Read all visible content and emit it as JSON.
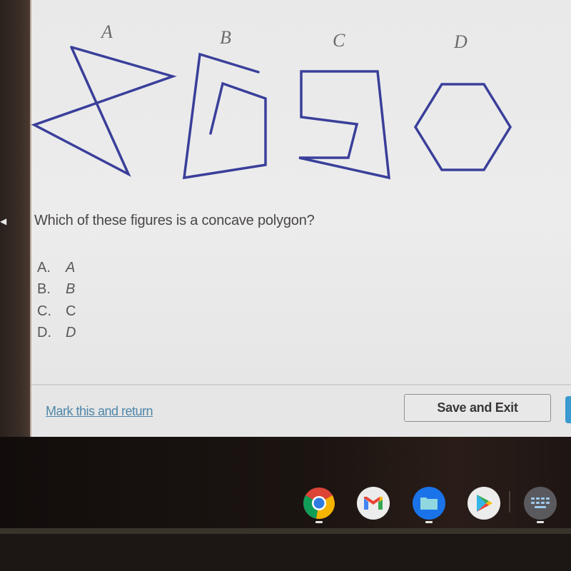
{
  "figures": {
    "labels": [
      "A",
      "B",
      "C",
      "D"
    ],
    "stroke_color": "#3a3f9a"
  },
  "question": {
    "text": "Which of these figures is a concave polygon?"
  },
  "options": [
    {
      "key": "A.",
      "value": "A"
    },
    {
      "key": "B.",
      "value": "B"
    },
    {
      "key": "C.",
      "value": "C"
    },
    {
      "key": "D.",
      "value": "D"
    }
  ],
  "footer": {
    "mark_link": "Mark this and return",
    "save_button": "Save and Exit"
  },
  "shelf": {
    "apps": [
      {
        "name": "chrome",
        "running": true
      },
      {
        "name": "gmail",
        "running": false
      },
      {
        "name": "files",
        "running": true
      },
      {
        "name": "play-store",
        "running": false
      },
      {
        "name": "keyboard-shortcuts",
        "running": true
      }
    ]
  },
  "colors": {
    "link": "#4f86a8",
    "primary_button": "#3a9ad0",
    "figure_stroke": "#3a3f9a"
  }
}
